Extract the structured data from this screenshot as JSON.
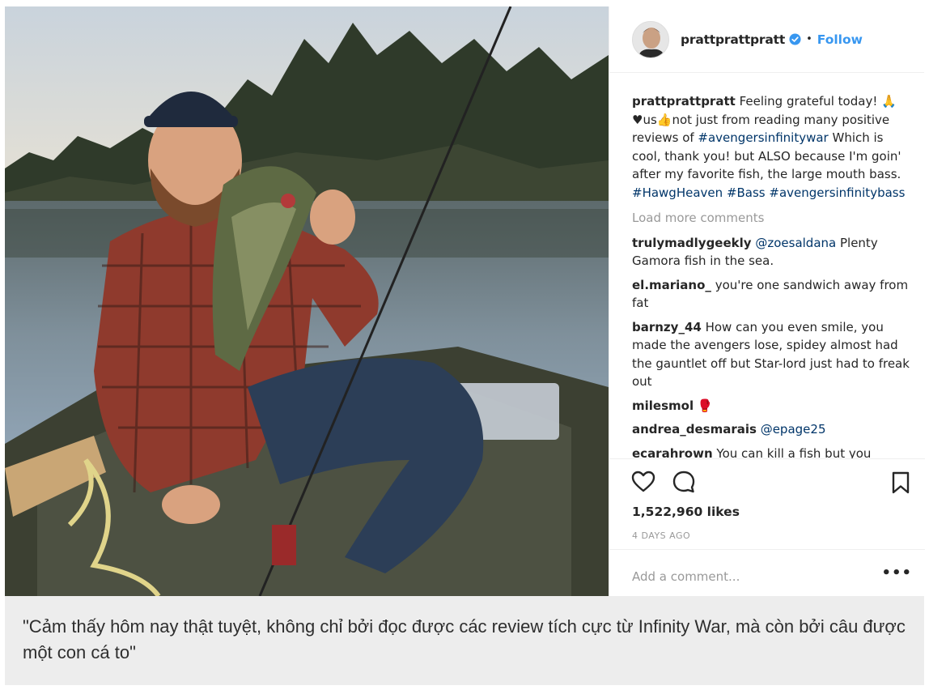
{
  "post": {
    "username": "prattprattpratt",
    "follow_label": "Follow",
    "separator": "•",
    "caption": {
      "user": "prattprattpratt",
      "text_1": " Feeling grateful today! ",
      "emoji_pray": "🙏",
      "text_2": " ♥us",
      "emoji_thumb": "👍",
      "text_3": "not just from reading many positive reviews of ",
      "tag_1": "#avengersinfinitywar",
      "text_4": " Which is cool, thank you! but ALSO because I'm goin' after my favorite fish, the large mouth bass. ",
      "tag_2": "#HawgHeaven",
      "tag_3": "#Bass",
      "tag_4": "#avengersinfinitybass"
    },
    "load_more": "Load more comments",
    "comments": [
      {
        "user": "trulymadlygeekly",
        "mention": "@zoesaldana",
        "text": " Plenty Gamora fish in the sea."
      },
      {
        "user": "el.mariano_",
        "mention": "",
        "text": " you're one sandwich away from fat"
      },
      {
        "user": "barnzy_44",
        "mention": "",
        "text": " How can you even smile, you made the avengers lose, spidey almost had the gauntlet off but Star-lord just had to freak out"
      },
      {
        "user": "milesmol",
        "mention": "",
        "text": " 🥊"
      },
      {
        "user": "andrea_desmarais",
        "mention": "@epage25",
        "text": ""
      },
      {
        "user": "ecarahrown",
        "mention": "",
        "text": " You can kill a fish but you"
      }
    ],
    "likes": "1,522,960 likes",
    "date": "4 DAYS AGO",
    "add_comment_placeholder": "Add a comment...",
    "more_options": "•••"
  },
  "caption_bar": {
    "text": "\"Cảm thấy hôm nay thật tuyệt, không chỉ bởi đọc được các review tích cực từ Infinity War, mà còn bởi câu được một con cá to\""
  },
  "icons": {
    "heart": "heart-icon",
    "comment": "comment-icon",
    "bookmark": "bookmark-icon",
    "verified": "verified-badge-icon"
  },
  "colors": {
    "link": "#3897f0",
    "hashtag": "#003569",
    "muted": "#999999",
    "caption_bg": "#ededed"
  }
}
